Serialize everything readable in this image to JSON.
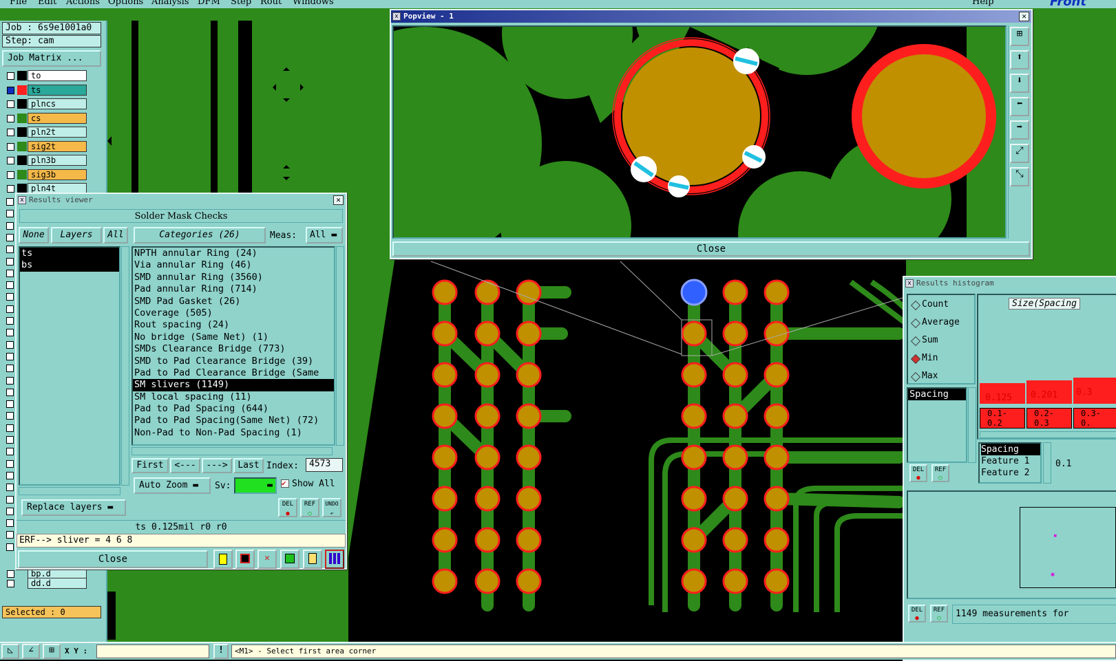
{
  "menu": [
    "File",
    "Edit",
    "Actions",
    "Options",
    "Analysis",
    "DFM",
    "Step",
    "Rout",
    "Windows",
    "Help"
  ],
  "brand": "Front",
  "left": {
    "job": "Job : 6s9e1001a0",
    "step": "Step: cam",
    "job_matrix": "Job Matrix ...",
    "layers": [
      {
        "name": "to",
        "color": "#ffffff",
        "sw": "#000000",
        "edit": true
      },
      {
        "name": "ts",
        "color": "#2aa89a",
        "sw": "#ff2020",
        "edit": true,
        "active": true
      },
      {
        "name": "plncs",
        "color": "#bfeee8",
        "sw": "#000000",
        "edit": false
      },
      {
        "name": "cs",
        "color": "#f5b94a",
        "sw": "#2e8a1a",
        "edit": true
      },
      {
        "name": "pln2t",
        "color": "#bfeee8",
        "sw": "#000000",
        "edit": false
      },
      {
        "name": "sig2t",
        "color": "#f5b94a",
        "sw": "#2e8a1a",
        "edit": true
      },
      {
        "name": "pln3b",
        "color": "#bfeee8",
        "sw": "#000000",
        "edit": false
      },
      {
        "name": "sig3b",
        "color": "#f5b94a",
        "sw": "#2e8a1a",
        "edit": true
      },
      {
        "name": "pln4t",
        "color": "#bfeee8",
        "sw": "#000000",
        "edit": false
      }
    ],
    "bottom_layers": [
      "bp.d",
      "dd.d"
    ],
    "selected": "Selected : 0"
  },
  "results_viewer": {
    "title": "Results viewer",
    "header": "Solder Mask Checks",
    "none_btn": "None",
    "layers_btn": "Layers",
    "all_btn": "All",
    "categories_btn": "Categories (26)",
    "meas_label": "Meas:",
    "meas_value": "All",
    "layer_list": [
      "ts",
      "bs"
    ],
    "categories": [
      "NPTH annular Ring (24)",
      "Via annular Ring (46)",
      "SMD annular Ring (3560)",
      "Pad annular Ring (714)",
      "SMD Pad Gasket (26)",
      "Coverage (505)",
      "Rout spacing (24)",
      "No bridge (Same Net) (1)",
      "SMDs Clearance Bridge (773)",
      "SMD to Pad Clearance Bridge (39)",
      "Pad to Pad Clearance Bridge (Same",
      "SM slivers (1149)",
      "SM local spacing (11)",
      "Pad to Pad Spacing (644)",
      "Pad to Pad Spacing(Same Net) (72)",
      "Non-Pad to Non-Pad Spacing (1)"
    ],
    "selected_category": 11,
    "first": "First",
    "prev": "<---",
    "next": "--->",
    "last": "Last",
    "index_label": "Index:",
    "index_value": "4573",
    "auto_zoom": "Auto Zoom",
    "sv_label": "Sv:",
    "show_all": "Show All",
    "replace_layers": "Replace layers",
    "del": "DEL",
    "ref": "REF",
    "undo": "UNDO",
    "info": "ts 0.125mil   r0   r0",
    "erf": "ERF--> sliver = 4 6 8",
    "close": "Close"
  },
  "popview": {
    "title": "Popview - 1",
    "close": "Close"
  },
  "histogram": {
    "title": "Results histogram",
    "options": [
      "Count",
      "Average",
      "Sum",
      "Min",
      "Max"
    ],
    "selected_option": "Min",
    "list": [
      "Spacing"
    ],
    "size_label": "Size(Spacing",
    "bar_values": [
      "0.125",
      "0.201",
      "0.3"
    ],
    "bins": [
      "0.1-\n0.2",
      "0.2-\n0.3",
      "0.3-\n0."
    ],
    "detail": [
      "Spacing",
      "Feature 1",
      "Feature 2"
    ],
    "value": "0.1",
    "del": "DEL",
    "ref": "REF",
    "measurements": "1149 measurements for"
  },
  "status": {
    "xy_label": "X Y :",
    "message": "<M1> - Select first area corner",
    "excl": "!"
  },
  "colors": {
    "panel": "#8fd3cb",
    "board": "#2e8a1a",
    "pad": "#c09000",
    "ring": "#ff1e1e",
    "select": "#1a9a55"
  }
}
